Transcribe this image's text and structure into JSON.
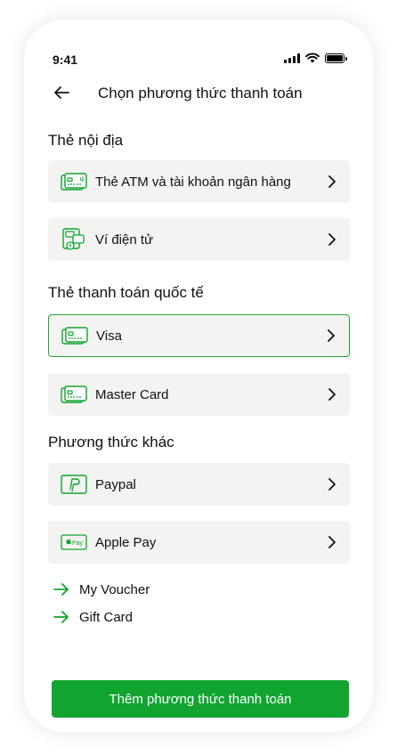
{
  "status_bar": {
    "time": "9:41"
  },
  "header": {
    "title": "Chọn phương thức thanh toán"
  },
  "sections": {
    "domestic": {
      "title": "Thẻ nội địa",
      "items": [
        {
          "label": "Thẻ ATM và tài khoản ngân hàng",
          "icon": "bank-card-icon"
        },
        {
          "label": "Ví điện tử",
          "icon": "e-wallet-icon"
        }
      ]
    },
    "international": {
      "title": "Thẻ thanh toán quốc tế",
      "items": [
        {
          "label": "Visa",
          "icon": "credit-card-icon",
          "selected": true
        },
        {
          "label": "Master Card",
          "icon": "credit-card-icon"
        }
      ]
    },
    "other": {
      "title": "Phương thức khác",
      "items": [
        {
          "label": "Paypal",
          "icon": "paypal-icon"
        },
        {
          "label": "Apple Pay",
          "icon": "apple-pay-icon",
          "badge": "Pay"
        }
      ]
    }
  },
  "links": [
    {
      "label": "My Voucher"
    },
    {
      "label": "Gift Card"
    }
  ],
  "cta": {
    "label": "Thêm phương thức thanh toán"
  },
  "colors": {
    "accent": "#11a431",
    "row_bg": "#f3f4f1",
    "selected_border": "#23a43a"
  }
}
